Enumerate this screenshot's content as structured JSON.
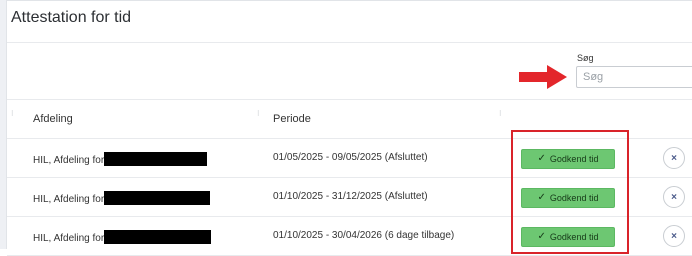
{
  "panel": {
    "title": "Attestation for tid"
  },
  "search": {
    "label": "Søg",
    "placeholder": "Søg",
    "value": ""
  },
  "table": {
    "columns": [
      "Afdeling",
      "Periode"
    ],
    "sort_glyph": "⁝",
    "rows": [
      {
        "department_prefix": "HIL, Afdeling for",
        "period": "01/05/2025 - 09/05/2025 (Afsluttet)",
        "approve_label": "Godkend tid",
        "remove_label": "×"
      },
      {
        "department_prefix": "HIL, Afdeling for",
        "period": "01/10/2025 - 31/12/2025 (Afsluttet)",
        "approve_label": "Godkend tid",
        "remove_label": "×"
      },
      {
        "department_prefix": "HIL, Afdeling for",
        "period": "01/10/2025 - 30/04/2026 (6 dage tilbage)",
        "approve_label": "Godkend tid",
        "remove_label": "×"
      }
    ]
  },
  "icons": {
    "check": "✓",
    "arrow": "arrow-right-icon"
  },
  "colors": {
    "approve_green": "#6dc772",
    "annotation_red": "#d9232a",
    "remove_icon_blue": "#4a5a8a"
  }
}
